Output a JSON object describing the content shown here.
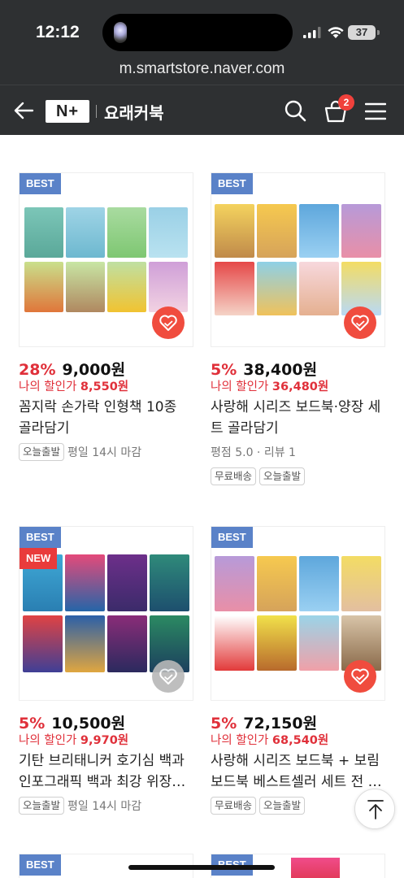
{
  "status_bar": {
    "time": "12:12",
    "battery": "37"
  },
  "browser": {
    "url": "m.smartstore.naver.com"
  },
  "header": {
    "logo": "N+",
    "store_name": "요래커북",
    "cart_count": "2"
  },
  "products": [
    {
      "tags": [
        "BEST"
      ],
      "discount": "28%",
      "price": "9,000원",
      "my_price_label": "나의 할인가",
      "my_price": "8,550원",
      "title": "꼼지락 손가락 인형책 10종 골라담기",
      "info": "",
      "chips": [
        "오늘출발"
      ],
      "chip_note": "평일 14시 마감",
      "wishlisted": true
    },
    {
      "tags": [
        "BEST"
      ],
      "discount": "5%",
      "price": "38,400원",
      "my_price_label": "나의 할인가",
      "my_price": "36,480원",
      "title": "사랑해 시리즈 보드북·양장 세트 골라담기",
      "info": "평점 5.0 · 리뷰 1",
      "chips": [
        "무료배송",
        "오늘출발"
      ],
      "chip_note": "",
      "wishlisted": true
    },
    {
      "tags": [
        "BEST",
        "NEW"
      ],
      "discount": "5%",
      "price": "10,500원",
      "my_price_label": "나의 할인가",
      "my_price": "9,970원",
      "title": "기탄 브리태니커 호기심 백과 인포그래픽 백과 최강 위장…",
      "info": "",
      "chips": [
        "오늘출발"
      ],
      "chip_note": "평일 14시 마감",
      "wishlisted": false
    },
    {
      "tags": [
        "BEST"
      ],
      "discount": "5%",
      "price": "72,150원",
      "my_price_label": "나의 할인가",
      "my_price": "68,540원",
      "title": "사랑해 시리즈 보드북 + 보림 보드북 베스트셀러 세트 전 …",
      "info": "",
      "chips": [
        "무료배송",
        "오늘출발"
      ],
      "chip_note": "",
      "wishlisted": true
    }
  ],
  "next_row_tags": [
    "BEST",
    "BEST"
  ],
  "colors": {
    "accent_red": "#e0303a",
    "best_tag": "#5a82c8",
    "new_tag": "#e93b3b",
    "header_bg": "#2e3032"
  }
}
